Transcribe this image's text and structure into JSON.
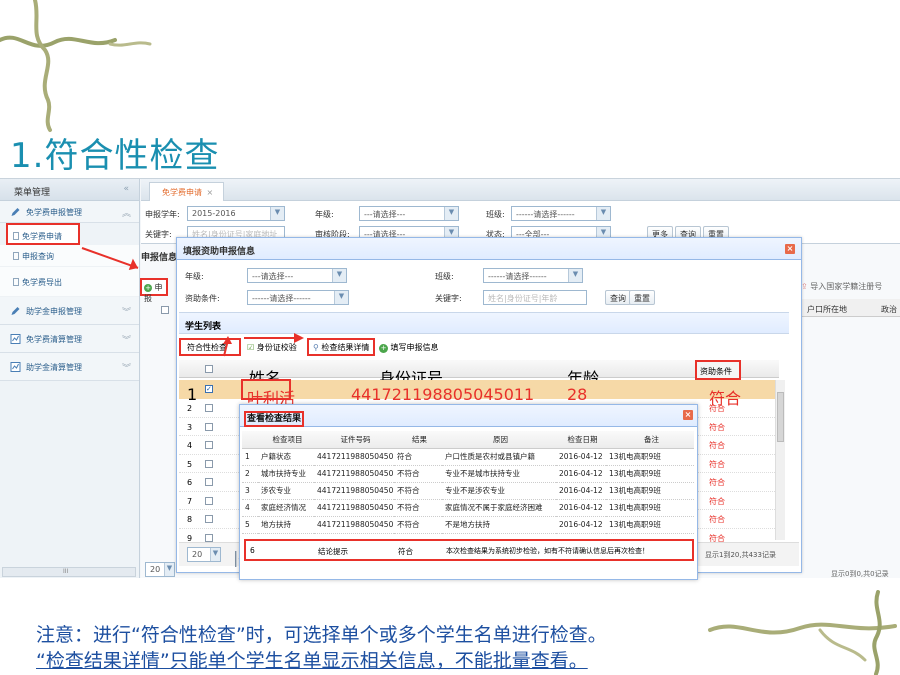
{
  "slide": {
    "title": "1.符合性检查",
    "note_line1": "注意：进行“符合性检查”时，可选择单个或多个学生名单进行检查。",
    "note_line2": "“检查结果详情”只能单个学生名单显示相关信息，不能批量查看。"
  },
  "sidebar": {
    "header": "菜单管理",
    "collapse_glyph": "«",
    "groups": [
      {
        "label": "免学费申报管理",
        "icon": "pencil-icon",
        "items": [
          {
            "label": "免学费申请",
            "active": true
          },
          {
            "label": "申报查询"
          },
          {
            "label": "免学费导出"
          }
        ]
      },
      {
        "label": "助学金申报管理",
        "icon": "pencil-icon"
      },
      {
        "label": "免学费清算管理",
        "icon": "chart-icon"
      },
      {
        "label": "助学金清算管理",
        "icon": "chart-icon"
      }
    ],
    "scroll_label": "III"
  },
  "main": {
    "tab_label": "免学费申请",
    "tab_close": "×",
    "filters": {
      "year_label": "申报学年:",
      "year_value": "2015-2016",
      "grade_label": "年级:",
      "grade_value": "---请选择---",
      "class_label": "班级:",
      "class_value": "------请选择------",
      "keyword_label": "关键字:",
      "keyword_placeholder": "姓名|身份证号|家庭地址",
      "stage_label": "审核阶段:",
      "stage_value": "---请选择---",
      "status_label": "状态:",
      "status_value": "---全部---",
      "more_btn": "更多",
      "query_btn": "查询",
      "reset_btn": "重置"
    },
    "panel_title": "申报信息",
    "apply_btn": "申报",
    "right_tool": "导入国家学籍注册号",
    "right_col1": "户口所在地",
    "right_col2": "政治",
    "right_footer": "显示0到0,共0记录",
    "bottom_page_size": "20"
  },
  "dialog1": {
    "title": "填报资助申报信息",
    "grade_label": "年级:",
    "grade_value": "---请选择---",
    "class_label": "班级:",
    "class_value": "------请选择------",
    "cond_label": "资助条件:",
    "cond_value": "------请选择------",
    "keyword_label": "关键字:",
    "keyword_placeholder": "姓名|身份证号|年龄",
    "query_btn": "查询",
    "reset_btn": "重置",
    "list_title": "学生列表",
    "toolbar": {
      "check_btn": "符合性检查",
      "idcheck_btn": "身份证校验",
      "detail_btn": "检查结果详情",
      "fill_btn": "填写申报信息"
    },
    "columns": [
      "姓名",
      "身份证号",
      "年龄",
      "资助条件"
    ],
    "selected_row": {
      "index": "1",
      "name": "叶利活",
      "id": "441721198805045011",
      "age": "28",
      "cond": "符合"
    },
    "row_numbers": [
      "2",
      "3",
      "4",
      "5",
      "6",
      "7",
      "8",
      "9"
    ],
    "cond_values": [
      "符合",
      "符合",
      "符合",
      "符合",
      "符合",
      "符合",
      "符合",
      "符合"
    ],
    "page_size": "20",
    "footer": "显示1到20,共433记录"
  },
  "dialog2": {
    "title": "查看检查结果",
    "columns": [
      "检查项目",
      "证件号码",
      "结果",
      "原因",
      "检查日期",
      "备注"
    ],
    "rows": [
      {
        "n": "1",
        "item": "户籍状态",
        "id": "441721198805045011",
        "result": "符合",
        "reason": "户口性质是农村或县镇户籍",
        "date": "2016-04-12",
        "note": "13机电高职9班"
      },
      {
        "n": "2",
        "item": "城市扶持专业",
        "id": "441721198805045011",
        "result": "不符合",
        "reason": "专业不是城市扶持专业",
        "date": "2016-04-12",
        "note": "13机电高职9班"
      },
      {
        "n": "3",
        "item": "涉农专业",
        "id": "441721198805045011",
        "result": "不符合",
        "reason": "专业不是涉农专业",
        "date": "2016-04-12",
        "note": "13机电高职9班"
      },
      {
        "n": "4",
        "item": "家庭经济情况",
        "id": "441721198805045011",
        "result": "不符合",
        "reason": "家庭情况不属于家庭经济困难",
        "date": "2016-04-12",
        "note": "13机电高职9班"
      },
      {
        "n": "5",
        "item": "地方扶持",
        "id": "441721198805045011",
        "result": "不符合",
        "reason": "不是地方扶持",
        "date": "2016-04-12",
        "note": "13机电高职9班"
      }
    ],
    "summary": {
      "n": "6",
      "item": "结论提示",
      "result": "符合",
      "reason": "本次检查结果为系统初步检验，如有不符请确认信息后再次检查！"
    }
  },
  "colors": {
    "title": "#1a8fb0",
    "note": "#1d4fa0",
    "highlight": "#e8312a",
    "selected_row": "#f6d9a7"
  }
}
